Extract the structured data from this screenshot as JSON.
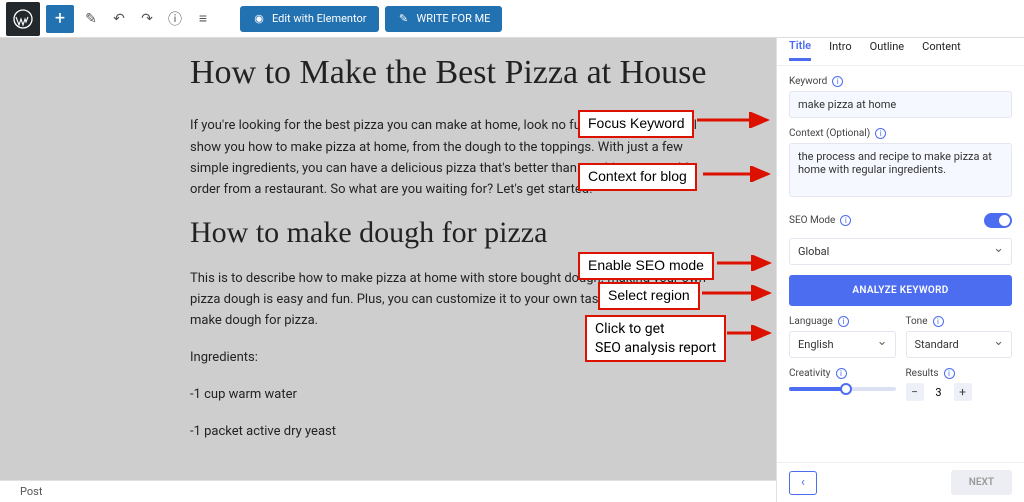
{
  "toolbar": {
    "edit_elementor": "Edit with Elementor",
    "write_for_me": "WRITE FOR ME"
  },
  "content": {
    "h1": "How to Make the Best Pizza at House",
    "p1": "If you're looking for the best pizza you can make at home, look no further! This guide will show you how to make pizza at home, from the dough to the toppings. With just a few simple ingredients, you can have a delicious pizza that's better than anything you could order from a restaurant. So what are you waiting for? Let's get started!",
    "h2": "How to make dough for pizza",
    "p2": "This is to describe how to make pizza at home with store bought dough. making your own pizza dough is easy and fun. Plus, you can customize it to your own taste. Here's how to make dough for pizza.",
    "p3": "Ingredients:",
    "p4": "-1 cup warm water",
    "p5": "-1 packet active dry yeast"
  },
  "status": {
    "text": "Post"
  },
  "panel": {
    "logo": "genie",
    "tabs": [
      "Title",
      "Intro",
      "Outline",
      "Content"
    ],
    "keyword_label": "Keyword",
    "keyword_value": "make pizza at home",
    "context_label": "Context (Optional)",
    "context_value": "the process and recipe to make pizza at home with regular ingredients.",
    "seo_mode_label": "SEO Mode",
    "region_value": "Global",
    "analyze_btn": "ANALYZE KEYWORD",
    "language_label": "Language",
    "language_value": "English",
    "tone_label": "Tone",
    "tone_value": "Standard",
    "creativity_label": "Creativity",
    "results_label": "Results",
    "results_value": "3",
    "next": "NEXT"
  },
  "annotations": {
    "a1": "Focus Keyword",
    "a2": "Context for blog",
    "a3": "Enable SEO mode",
    "a4": "Select region",
    "a5_l1": "Click to get",
    "a5_l2": "SEO analysis report"
  }
}
